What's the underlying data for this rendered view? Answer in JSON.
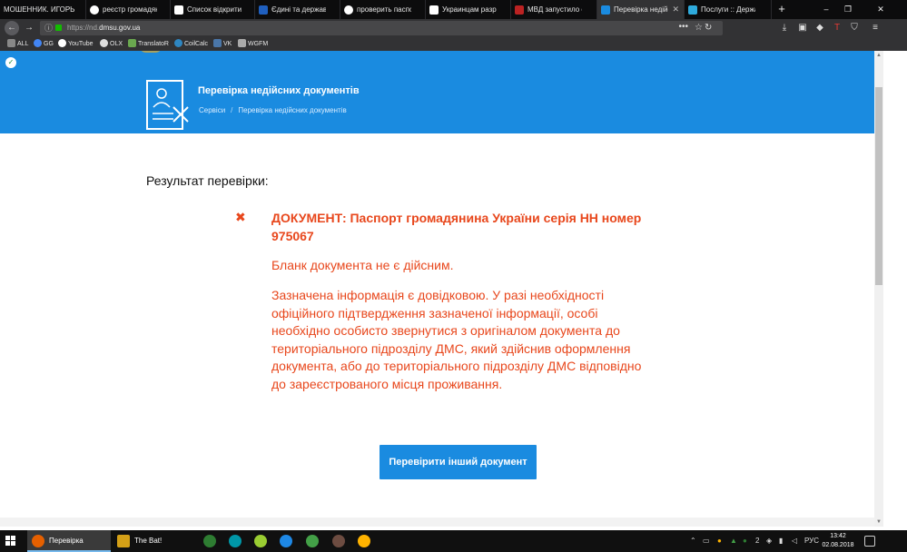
{
  "browser": {
    "tabs": [
      {
        "title": "МОШЕННИК. ИГОРЬ Б",
        "favicon_color": "#333"
      },
      {
        "title": "реєстр громадян у",
        "favicon_color": "#4285f4"
      },
      {
        "title": "Список відкритих",
        "favicon_color": "#2b5797"
      },
      {
        "title": "Єдині та державні",
        "favicon_color": "#f7c400"
      },
      {
        "title": "проверить паспор",
        "favicon_color": "#4285f4"
      },
      {
        "title": "Украинцам разреш",
        "favicon_color": "#1a4f9c"
      },
      {
        "title": "МВД запустило он",
        "favicon_color": "#c0392b"
      },
      {
        "title": "Перевірка недійсн",
        "favicon_color": "#1a8be0"
      },
      {
        "title": "Послуги :: Держав",
        "favicon_color": "#2eaadc"
      }
    ],
    "new_tab_label": "+",
    "window_controls": {
      "minimize": "‒",
      "restore": "❐",
      "close": "✕"
    },
    "url_prefix": "https://nd.",
    "url_domain": "dmsu.gov.ua",
    "page_actions": "•••",
    "bookmark_star": "☆",
    "bookmarks": [
      {
        "label": "ALL",
        "color": "#888"
      },
      {
        "label": "GG",
        "color": "#4285f4"
      },
      {
        "label": "YouTube",
        "color": "#ff0000"
      },
      {
        "label": "OLX",
        "color": "#3a77ff"
      },
      {
        "label": "TranslatoR",
        "color": "#6aa84f"
      },
      {
        "label": "CoilCalc",
        "color": "#2e86c1"
      },
      {
        "label": "VK",
        "color": "#4a76a8"
      },
      {
        "label": "WGFM",
        "color": "#aaa"
      }
    ]
  },
  "page": {
    "banner_title": "Перевірка недійсних документів",
    "breadcrumb": [
      "Сервіси",
      "Перевірка недійсних документів"
    ],
    "breadcrumb_sep": "/",
    "result_title": "Результат перевірки:",
    "error_mark": "✖",
    "document_heading": "ДОКУМЕНТ: Паспорт громадянина України серія НН номер 975067",
    "blank_status": "Бланк документа не є дійсним.",
    "info_text": "Зазначена інформація є довідковою. У разі необхідності офіційного підтвердження зазначеної інформації, особі необхідно особисто звернутися з оригіналом документа до територіального підрозділу ДМС, який здійснив оформлення документа, або до територіального підрозділу ДМС відповідно до зареєстрованого місця проживання.",
    "check_another_button": "Перевірити інший документ",
    "accent_color": "#1a8be0",
    "error_color": "#e8471c"
  },
  "taskbar": {
    "tasks": [
      {
        "label": "Перевірка недійсн...",
        "active": true
      },
      {
        "label": "The Bat!",
        "active": false
      }
    ],
    "tray_badge": "2",
    "language": "РУС",
    "time": "13:42",
    "date": "02.08.2018"
  }
}
